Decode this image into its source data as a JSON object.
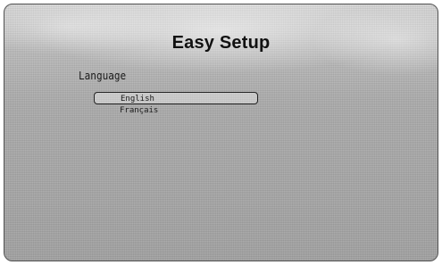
{
  "screen": {
    "title": "Easy Setup"
  },
  "language": {
    "label": "Language",
    "options": [
      {
        "label": "English",
        "selected": true
      },
      {
        "label": "Français",
        "selected": false
      }
    ]
  }
}
